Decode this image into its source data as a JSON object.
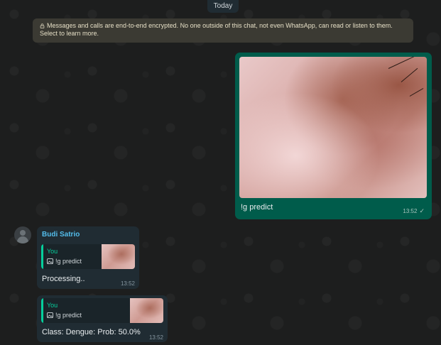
{
  "chat": {
    "date_label": "Today",
    "encryption_notice": "Messages and calls are end-to-end encrypted. No one outside of this chat, not even WhatsApp, can read or listen to them. Select to learn more."
  },
  "messages": [
    {
      "direction": "outgoing",
      "type": "image",
      "caption": "!g predict",
      "time": "13:52",
      "status_icon": "double-check-icon"
    },
    {
      "direction": "incoming",
      "sender": "Budi Satrio",
      "quote": {
        "author": "You",
        "text": "!g predict",
        "icon": "photo-icon"
      },
      "text": "Processing..",
      "time": "13:52"
    },
    {
      "direction": "incoming",
      "quote": {
        "author": "You",
        "text": "!g predict",
        "icon": "photo-icon"
      },
      "text": "Class: Dengue: Prob: 50.0%",
      "time": "13:52"
    }
  ],
  "colors": {
    "outgoing_bubble": "#005c4b",
    "incoming_bubble": "#202c33",
    "sender_name": "#53bdeb",
    "quote_accent": "#06cf9c",
    "notice_background": "#3b3a33"
  }
}
